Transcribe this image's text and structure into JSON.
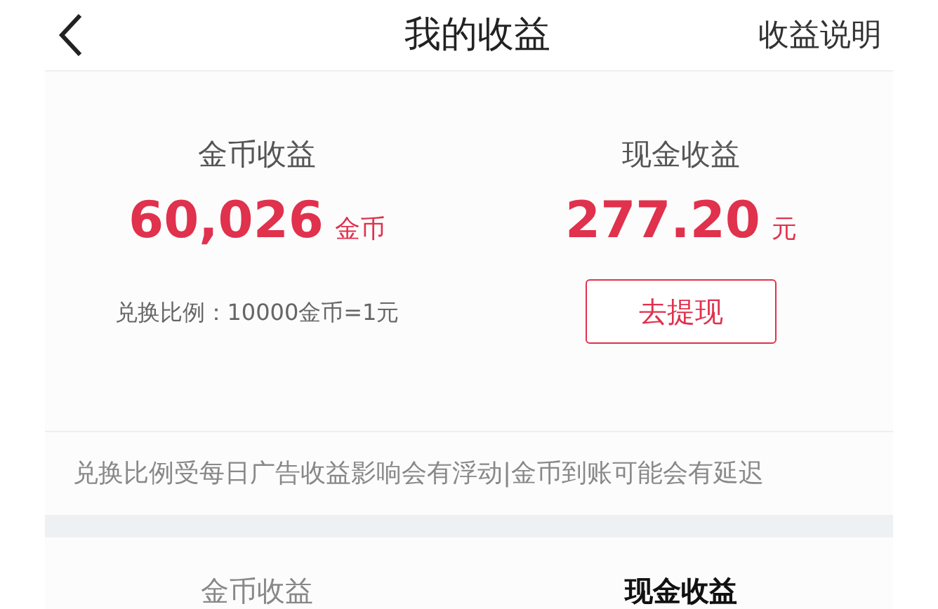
{
  "header": {
    "title": "我的收益",
    "action": "收益说明"
  },
  "earnings": [
    {
      "label": "金币收益",
      "amount": "60,026",
      "unit": "金币",
      "kind": "rate",
      "rate": "兑换比例：10000金币=1元"
    },
    {
      "label": "现金收益",
      "amount": "277.20",
      "unit": "元",
      "kind": "button",
      "button": "去提现"
    }
  ],
  "note": "兑换比例受每日广告收益影响会有浮动|金币到账可能会有延迟",
  "tabs": [
    {
      "label": "金币收益",
      "selected": false
    },
    {
      "label": "现金收益",
      "selected": true
    }
  ]
}
